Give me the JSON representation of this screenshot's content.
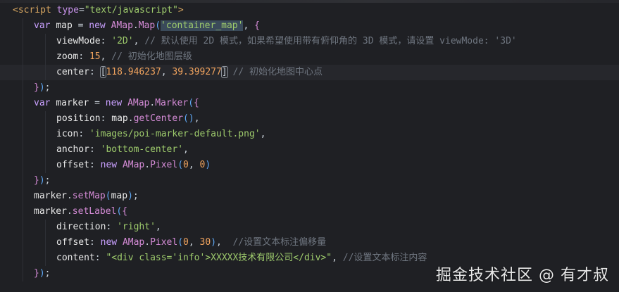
{
  "editor": {
    "lines": [
      {
        "tokens": [
          [
            "tag",
            "<script"
          ],
          [
            "punct",
            " "
          ],
          [
            "attr",
            "type"
          ],
          [
            "punct",
            "="
          ],
          [
            "str",
            "\"text/javascript\""
          ],
          [
            "tag",
            ">"
          ]
        ]
      },
      {
        "tokens": [
          [
            "kw",
            "var"
          ],
          [
            "punct",
            " "
          ],
          [
            "var",
            "map"
          ],
          [
            "punct",
            " = "
          ],
          [
            "kw",
            "new"
          ],
          [
            "punct",
            " "
          ],
          [
            "cls",
            "AMap"
          ],
          [
            "punct",
            "."
          ],
          [
            "cls",
            "Map"
          ],
          [
            "paren",
            "("
          ],
          [
            "str",
            "'container_map'"
          ],
          [
            "punct",
            ", "
          ],
          [
            "brace",
            "{"
          ]
        ]
      },
      {
        "tokens": [
          [
            "prop",
            "viewMode"
          ],
          [
            "punct",
            ": "
          ],
          [
            "str",
            "'2D'"
          ],
          [
            "punct",
            ", "
          ],
          [
            "cmt",
            "// 默认使用 2D 模式，如果希望使用带有俯仰角的 3D 模式，请设置 viewMode: '3D'"
          ]
        ]
      },
      {
        "tokens": [
          [
            "prop",
            "zoom"
          ],
          [
            "punct",
            ": "
          ],
          [
            "num",
            "15"
          ],
          [
            "punct",
            ", "
          ],
          [
            "cmt",
            "// 初始化地图层级"
          ]
        ]
      },
      {
        "tokens": [
          [
            "prop",
            "center"
          ],
          [
            "punct",
            ": "
          ],
          [
            "bracket",
            "["
          ],
          [
            "num",
            "118.946237"
          ],
          [
            "punct",
            ", "
          ],
          [
            "num",
            "39.399277"
          ],
          [
            "bracket",
            "]"
          ],
          [
            "punct",
            " "
          ],
          [
            "cmt",
            "// 初始化地图中心点"
          ]
        ]
      },
      {
        "tokens": [
          [
            "brace",
            "}"
          ],
          [
            "paren",
            ")"
          ],
          [
            "punct",
            ";"
          ]
        ]
      },
      {
        "tokens": [
          [
            "kw",
            "var"
          ],
          [
            "punct",
            " "
          ],
          [
            "var",
            "marker"
          ],
          [
            "punct",
            " = "
          ],
          [
            "kw",
            "new"
          ],
          [
            "punct",
            " "
          ],
          [
            "cls",
            "AMap"
          ],
          [
            "punct",
            "."
          ],
          [
            "cls",
            "Marker"
          ],
          [
            "paren",
            "("
          ],
          [
            "brace",
            "{"
          ]
        ]
      },
      {
        "tokens": [
          [
            "prop",
            "position"
          ],
          [
            "punct",
            ": "
          ],
          [
            "var",
            "map"
          ],
          [
            "punct",
            "."
          ],
          [
            "fn",
            "getCenter"
          ],
          [
            "paren",
            "()"
          ],
          [
            "punct",
            ","
          ]
        ]
      },
      {
        "tokens": [
          [
            "prop",
            "icon"
          ],
          [
            "punct",
            ": "
          ],
          [
            "str",
            "'images/poi-marker-default.png'"
          ],
          [
            "punct",
            ","
          ]
        ]
      },
      {
        "tokens": [
          [
            "prop",
            "anchor"
          ],
          [
            "punct",
            ": "
          ],
          [
            "str",
            "'bottom-center'"
          ],
          [
            "punct",
            ","
          ]
        ]
      },
      {
        "tokens": [
          [
            "prop",
            "offset"
          ],
          [
            "punct",
            ": "
          ],
          [
            "kw",
            "new"
          ],
          [
            "punct",
            " "
          ],
          [
            "cls",
            "AMap"
          ],
          [
            "punct",
            "."
          ],
          [
            "cls",
            "Pixel"
          ],
          [
            "paren",
            "("
          ],
          [
            "num",
            "0"
          ],
          [
            "punct",
            ", "
          ],
          [
            "num",
            "0"
          ],
          [
            "paren",
            ")"
          ]
        ]
      },
      {
        "tokens": [
          [
            "brace",
            "}"
          ],
          [
            "paren",
            ")"
          ],
          [
            "punct",
            ";"
          ]
        ]
      },
      {
        "tokens": [
          [
            "var",
            "marker"
          ],
          [
            "punct",
            "."
          ],
          [
            "fn",
            "setMap"
          ],
          [
            "paren",
            "("
          ],
          [
            "var",
            "map"
          ],
          [
            "paren",
            ")"
          ],
          [
            "punct",
            ";"
          ]
        ]
      },
      {
        "tokens": [
          [
            "var",
            "marker"
          ],
          [
            "punct",
            "."
          ],
          [
            "fn",
            "setLabel"
          ],
          [
            "paren",
            "("
          ],
          [
            "brace",
            "{"
          ]
        ]
      },
      {
        "tokens": [
          [
            "prop",
            "direction"
          ],
          [
            "punct",
            ": "
          ],
          [
            "str",
            "'right'"
          ],
          [
            "punct",
            ","
          ]
        ]
      },
      {
        "tokens": [
          [
            "prop",
            "offset"
          ],
          [
            "punct",
            ": "
          ],
          [
            "kw",
            "new"
          ],
          [
            "punct",
            " "
          ],
          [
            "cls",
            "AMap"
          ],
          [
            "punct",
            "."
          ],
          [
            "cls",
            "Pixel"
          ],
          [
            "paren",
            "("
          ],
          [
            "num",
            "0"
          ],
          [
            "punct",
            ", "
          ],
          [
            "num",
            "30"
          ],
          [
            "paren",
            ")"
          ],
          [
            "punct",
            ",  "
          ],
          [
            "cmt",
            "//设置文本标注偏移量"
          ]
        ]
      },
      {
        "tokens": [
          [
            "prop",
            "content"
          ],
          [
            "punct",
            ": "
          ],
          [
            "str",
            "\"<div class='info'>XXXXX技术有限公司</div>\""
          ],
          [
            "punct",
            ", "
          ],
          [
            "cmt",
            "//设置文本标注内容"
          ]
        ]
      },
      {
        "tokens": [
          [
            "brace",
            "}"
          ],
          [
            "paren",
            ")"
          ],
          [
            "punct",
            ";"
          ]
        ]
      }
    ]
  },
  "watermark": "掘金技术社区 @ 有才叔",
  "colors": {
    "background": "#1f2024",
    "active_line": "#26272c",
    "keyword": "#c9a0ff",
    "string": "#9ecb6c",
    "number": "#f0a35e",
    "comment": "#6f7680",
    "tag": "#d3a35f"
  }
}
